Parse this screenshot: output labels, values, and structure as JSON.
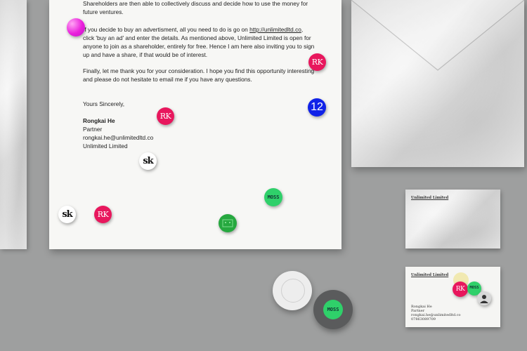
{
  "letter": {
    "para1": "Shareholders are then able to collectively discuss and decide how to use the money for future ventures.",
    "para2_before": "If you decide to buy an advertisment, all you need to do is go on ",
    "para2_link": "http://unlimitedltd.co",
    "para2_after": ", click 'buy an ad' and enter the details. As mentioned above, Unlimited Limited is open for anyone to join as a shareholder, entirely for free. Hence I am here also inviting you to sign up and have a share, if that would be of interest.",
    "para3": "Finally, let me thank you for your consideration. I hope you find this opportunity interesting and please do not hesitate to email me if you have any questions.",
    "closing": "Yours Sincerely,",
    "signature": {
      "name": "Rongkai He",
      "title": "Partner",
      "email": "rongkai.he@unlimitedltd.co",
      "company": "Unlimited Limited"
    }
  },
  "business_card": {
    "company": "Unlimited Limited",
    "name": "Rongkai He",
    "title": "Partner",
    "email": "rongkai.he@unlimitedltd.co",
    "phone": "07863089709"
  },
  "badges": {
    "rk": "RK",
    "sk": "sk",
    "moss_line1": "MO",
    "moss_line2": "SS",
    "number": "12"
  },
  "colors": {
    "rk_pink": "#e8175d",
    "moss_green": "#2fd06a",
    "number_blue": "#1022e8",
    "background_grey": "#9e9f9f"
  }
}
